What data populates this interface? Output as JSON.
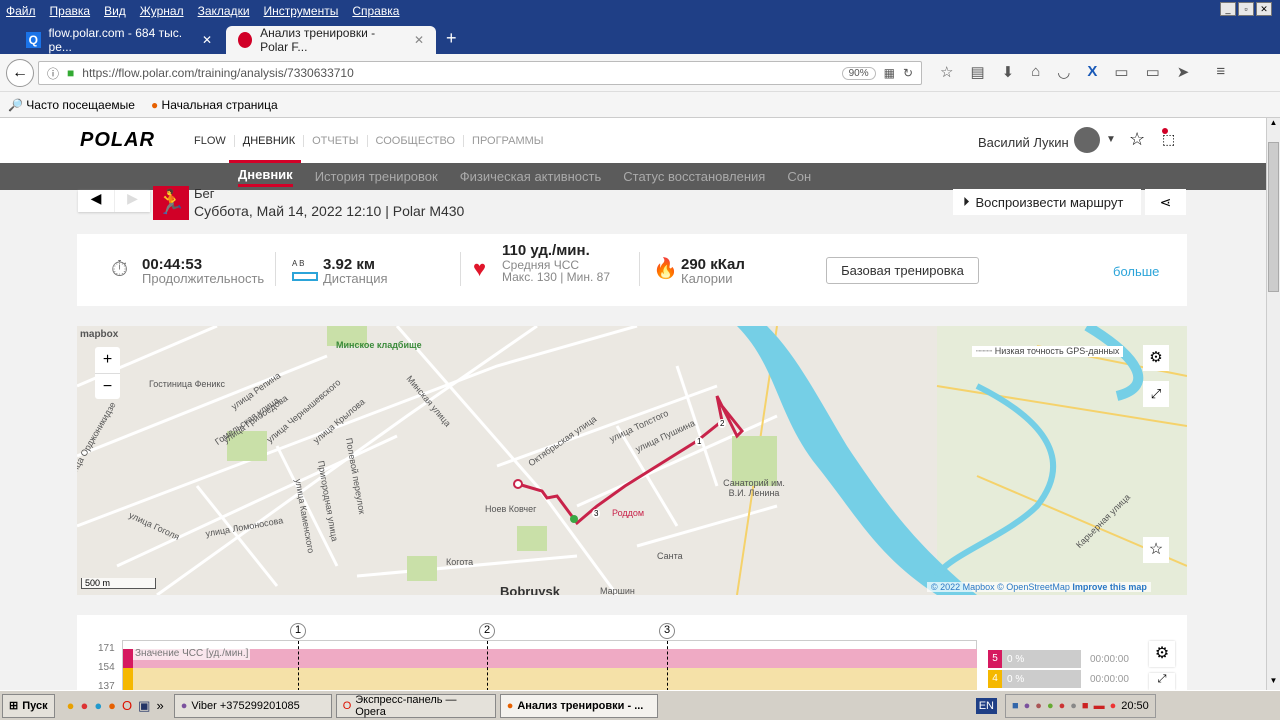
{
  "browser": {
    "menu": [
      "Файл",
      "Правка",
      "Вид",
      "Журнал",
      "Закладки",
      "Инструменты",
      "Справка"
    ],
    "tabs": [
      {
        "label": "flow.polar.com - 684 тыс. ре..."
      },
      {
        "label": "Анализ тренировки - Polar F..."
      }
    ],
    "url": "https://flow.polar.com/training/analysis/7330633710",
    "zoom": "90%",
    "bookmarks": [
      "Часто посещаемые",
      "Начальная страница"
    ]
  },
  "polar": {
    "logo": "POLAR",
    "nav": [
      "FLOW",
      "ДНЕВНИК",
      "ОТЧЕТЫ",
      "СООБЩЕСТВО",
      "ПРОГРАММЫ"
    ],
    "user": "Василий Лукин",
    "subnav": [
      "Дневник",
      "История тренировок",
      "Физическая активность",
      "Статус восстановления",
      "Сон"
    ]
  },
  "session": {
    "sport": "Бег",
    "subtitle": "Суббота, Май 14, 2022 12:10 | Polar M430",
    "replay": "Воспроизвести маршрут"
  },
  "summary": {
    "duration": {
      "value": "00:44:53",
      "label": "Продолжительность"
    },
    "distance": {
      "value": "3.92 км",
      "label": "Дистанция",
      "ab": "A  B"
    },
    "hr": {
      "value": "110 уд./мин.",
      "label": "Средняя ЧСС",
      "detail": "Макс. 130  |  Мин. 87"
    },
    "calories": {
      "value": "290 кКал",
      "label": "Калории"
    },
    "base_button": "Базовая тренировка",
    "more": "больше"
  },
  "map": {
    "logo": "mapbox",
    "gps_legend": "Низкая точность GPS-данных",
    "scale": "500 m",
    "attribution": "© 2022 Mapbox © OpenStreetMap",
    "improve": "Improve this map",
    "labels": [
      "Минское кладбище",
      "Гостиница Феникс",
      "улица Репина",
      "улица Грибоедова",
      "Гомельская улица",
      "улица Чернышевского",
      "улица Крылова",
      "Минская улица",
      "Октябрьская улица",
      "улица Толстого",
      "улица Пушкина",
      "Санаторий им. В.И. Ленина",
      "Роддом",
      "Ноев Ковчег",
      "Когота",
      "Санта",
      "Маршин",
      "Bobruysk",
      "улица Ломоносова",
      "улица Гоголя",
      "Полевой переулок",
      "Пригородная улица",
      "улица Каменского",
      "Карьерная улица",
      "улица Орджоникидзе"
    ],
    "laps": [
      "1",
      "2",
      "3"
    ]
  },
  "hrchart": {
    "legend": "Значение ЧСС [уд./мин.]",
    "yticks": [
      "171",
      "154",
      "137"
    ],
    "laps": [
      "1",
      "2",
      "3"
    ],
    "zones": [
      {
        "zone": "5",
        "pct": "0 %",
        "time": "00:00:00",
        "color": "#d6195f"
      },
      {
        "zone": "4",
        "pct": "0 %",
        "time": "00:00:00",
        "color": "#f5b800"
      }
    ]
  },
  "taskbar": {
    "start": "Пуск",
    "items": [
      "Viber +375299201085",
      "Экспресс-панель — Opera",
      "Анализ тренировки - ..."
    ],
    "lang": "EN",
    "clock": "20:50"
  }
}
